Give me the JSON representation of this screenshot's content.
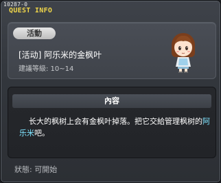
{
  "quest": {
    "id": "10287-0",
    "window_title": "QUEST INFO",
    "category_badge": "活動",
    "name": "[活动]  阿乐米的金枫叶",
    "level_label": "建議等級: 10~14"
  },
  "content": {
    "header": "內容",
    "description_part1": "长大的枫树上会有金枫叶掉落。把它交給管理枫树的",
    "description_npc": "阿乐米",
    "description_part2": "吧。"
  },
  "footer": {
    "status": "狀態:  可開始"
  },
  "colors": {
    "title": "#f0d64a",
    "npc_highlight": "#7fe4ff"
  },
  "icons": {
    "npc_portrait": "girl-npc-portrait"
  }
}
